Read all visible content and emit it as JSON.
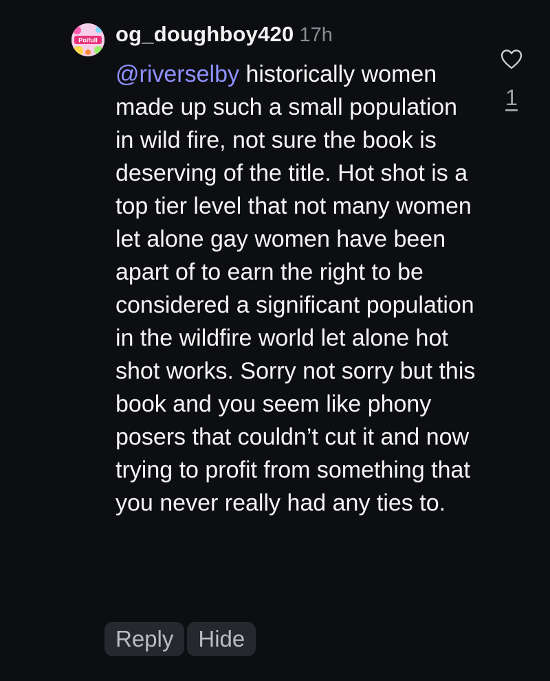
{
  "comment": {
    "avatar_icon": "user-avatar-icon",
    "avatar_text": "Poifull",
    "username": "og_doughboy420",
    "timestamp": "17h",
    "mention": "@riverselby",
    "text": " historically women made up such a small population in wild fire, not sure the book is deserving of the title. Hot shot is a top tier level that not many women let alone gay women have been apart of to earn the right to be considered a significant population in the wildfire world let alone hot shot works. Sorry not sorry but this book and you seem like phony posers that couldn’t cut it and now trying to profit from something that you never really had any ties to."
  },
  "actions": {
    "reply_label": "Reply",
    "hide_label": "Hide"
  },
  "likes": {
    "icon": "heart-icon",
    "count": "1"
  },
  "colors": {
    "background": "#0d0e12",
    "mention": "#8f92ff",
    "chip_background": "#26282d"
  }
}
